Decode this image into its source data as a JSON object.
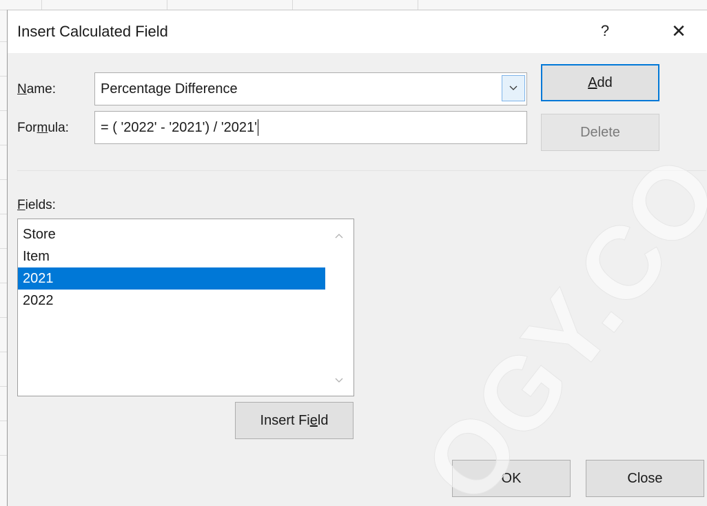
{
  "dialog": {
    "title": "Insert Calculated Field",
    "help_label": "?",
    "close_glyph": "✕"
  },
  "name_field": {
    "label_pre": "",
    "label_accel": "N",
    "label_post": "ame:",
    "value": "Percentage Difference"
  },
  "formula_field": {
    "label_pre": "For",
    "label_accel": "m",
    "label_post": "ula:",
    "value": "= ( '2022' - '2021') / '2021'"
  },
  "buttons": {
    "add_pre": "",
    "add_accel": "A",
    "add_post": "dd",
    "delete": "Delete",
    "insert_field_pre": "Insert Fi",
    "insert_field_accel": "e",
    "insert_field_post": "ld",
    "ok": "OK",
    "close": "Close"
  },
  "fields": {
    "label_pre": "",
    "label_accel": "F",
    "label_post": "ields:",
    "items": [
      "Store",
      "Item",
      "2021",
      "2022"
    ],
    "selected_index": 2
  },
  "watermark_text": "OGY.CO",
  "colors": {
    "accent": "#0078d7",
    "selection": "#0078d7",
    "dialog_bg": "#f0f0f0"
  }
}
